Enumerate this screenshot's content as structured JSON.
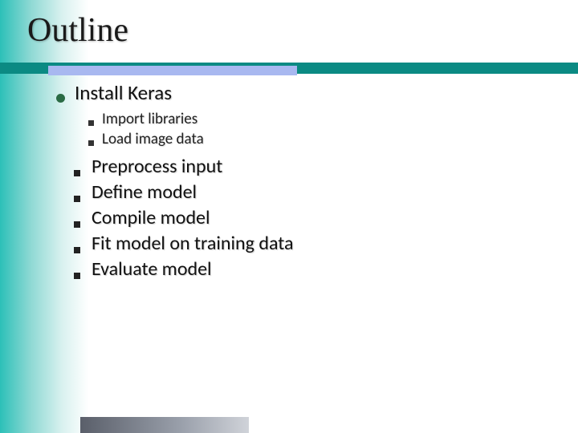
{
  "title": "Outline",
  "main_item": "Install Keras",
  "sub_items": [
    "Import libraries",
    "Load image data"
  ],
  "steps": [
    "Preprocess input",
    "Define model",
    "Compile model",
    "Fit model on training data",
    "Evaluate model"
  ]
}
